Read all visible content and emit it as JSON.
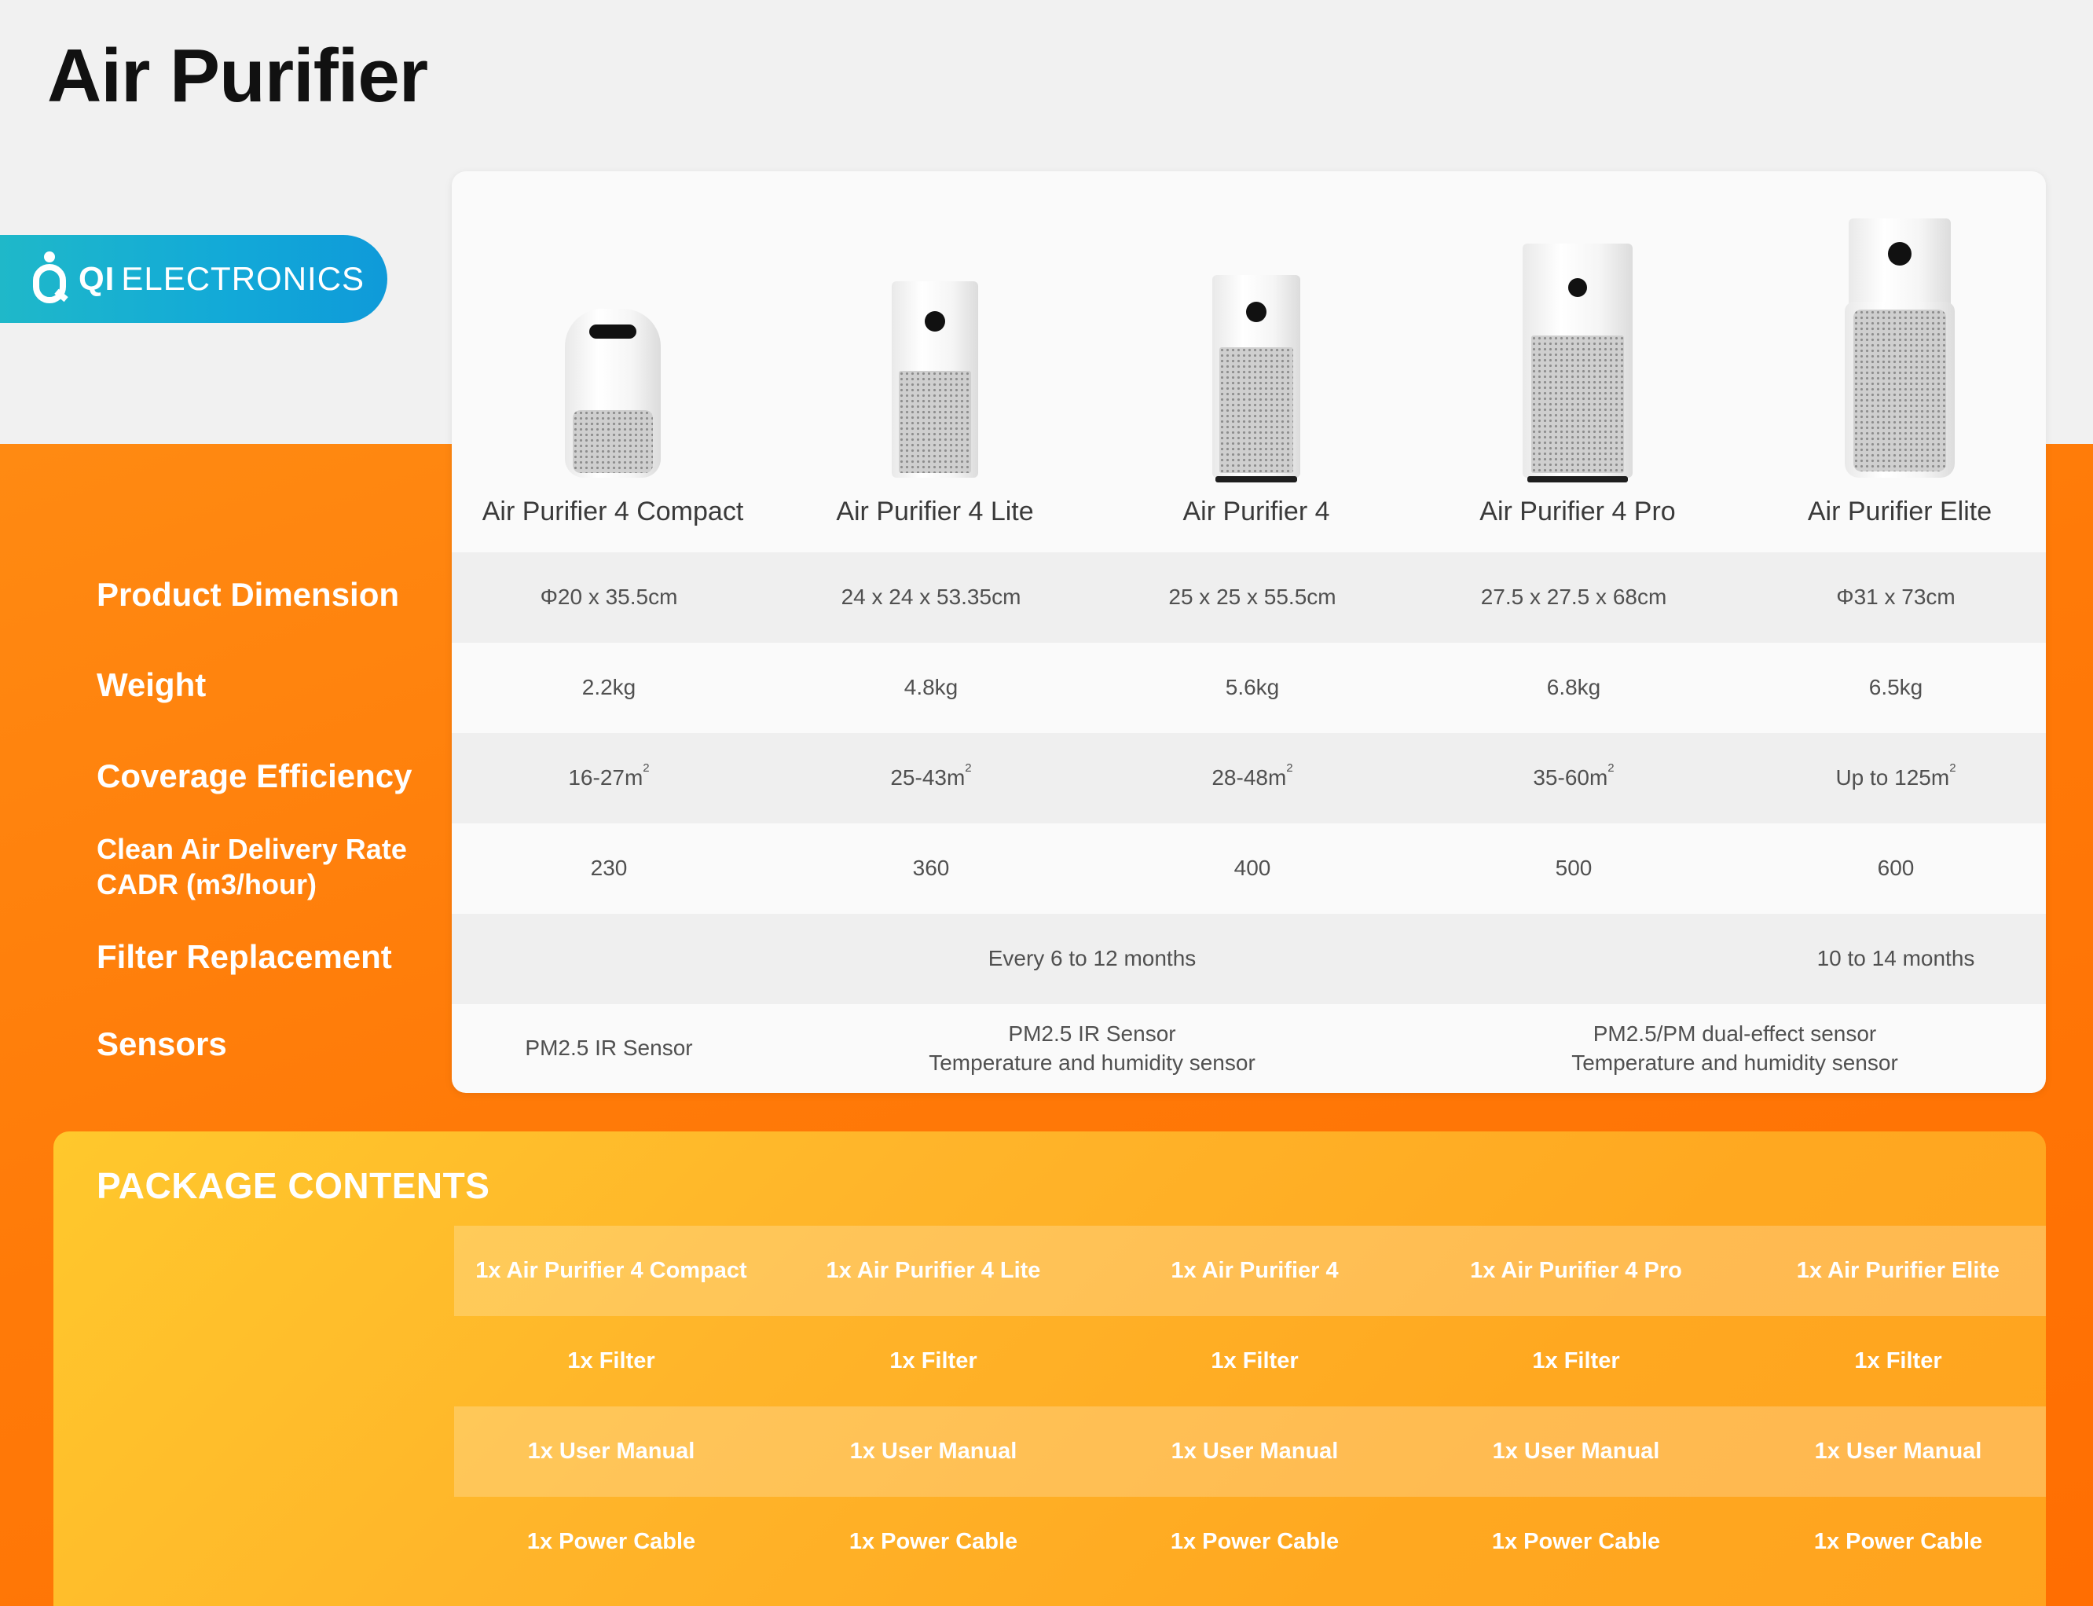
{
  "header": {
    "title": "Air Purifier"
  },
  "brand": {
    "bold": "QI",
    "name": "ELECTRONICS"
  },
  "products": [
    {
      "name": "Air Purifier 4 Compact",
      "dimension": "Φ20 x 35.5cm",
      "weight": "2.2kg",
      "coverage": "16-27m",
      "cadr": "230"
    },
    {
      "name": "Air Purifier 4 Lite",
      "dimension": "24 x 24 x 53.35cm",
      "weight": "4.8kg",
      "coverage": "25-43m",
      "cadr": "360"
    },
    {
      "name": "Air Purifier 4",
      "dimension": "25 x 25 x 55.5cm",
      "weight": "5.6kg",
      "coverage": "28-48m",
      "cadr": "400"
    },
    {
      "name": "Air Purifier 4 Pro",
      "dimension": "27.5 x 27.5 x 68cm",
      "weight": "6.8kg",
      "coverage": "35-60m",
      "cadr": "500"
    },
    {
      "name": "Air Purifier Elite",
      "dimension": "Φ31 x 73cm",
      "weight": "6.5kg",
      "coverage": "Up to 125m",
      "cadr": "600"
    }
  ],
  "unit_superscript": "2",
  "labels": {
    "dimension": "Product Dimension",
    "weight": "Weight",
    "coverage": "Coverage Efficiency",
    "cadr_line1": "Clean Air Delivery Rate",
    "cadr_line2": "CADR (m3/hour)",
    "filter": "Filter Replacement",
    "sensors": "Sensors"
  },
  "filter": {
    "group1": "Every 6 to 12 months",
    "group2": "10 to 14 months"
  },
  "sensors": {
    "compact": "PM2.5 IR Sensor",
    "lite_and_4_line1": "PM2.5 IR Sensor",
    "lite_and_4_line2": "Temperature and humidity sensor",
    "pro_and_elite_line1": "PM2.5/PM dual-effect sensor",
    "pro_and_elite_line2": "Temperature and humidity sensor"
  },
  "package": {
    "title": "PACKAGE CONTENTS",
    "units": [
      "1x Air Purifier 4 Compact",
      "1x Air Purifier 4 Lite",
      "1x Air Purifier 4",
      "1x Air Purifier 4 Pro",
      "1x Air Purifier Elite"
    ],
    "filter": "1x Filter",
    "manual": "1x User Manual",
    "cable": "1x Power Cable"
  }
}
